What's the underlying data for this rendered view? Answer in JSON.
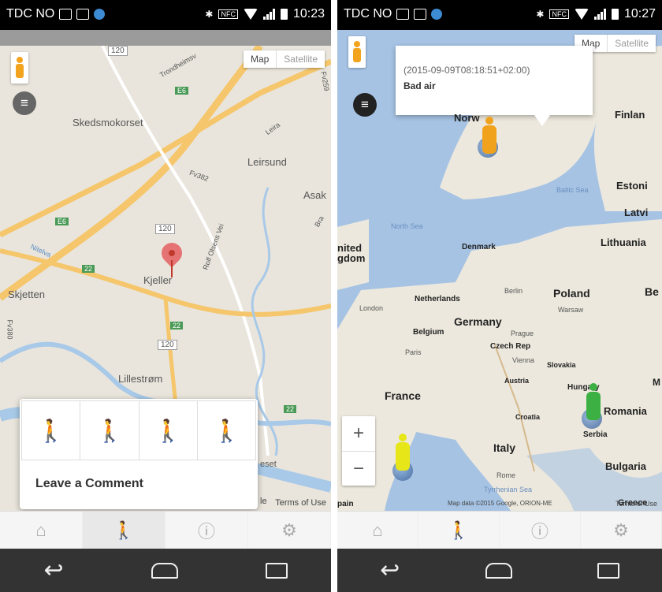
{
  "status_bar": {
    "carrier": "TDC NO",
    "nfc": "NFC",
    "time_left": "10:23",
    "time_right": "10:27"
  },
  "map_type": {
    "map": "Map",
    "satellite": "Satellite"
  },
  "map1": {
    "labels": {
      "skedsmokorset": "Skedsmokorset",
      "leirsund": "Leirsund",
      "asak": "Asak",
      "kjeller": "Kjeller",
      "skjetten": "Skjetten",
      "lillestrom": "Lillestrøm",
      "trondheimsveien": "Trondheimsv",
      "leira": "Leira",
      "fv382": "Fv382",
      "fv259": "Fv259",
      "e6_top": "E6",
      "e6_left": "E6",
      "r120_top": "120",
      "r120_mid": "120",
      "r120_bottom": "120",
      "r22_left": "22",
      "r22_mid": "22",
      "r22_right": "22",
      "nitelva": "Nitelva",
      "rolf": "Rolf Olsens Vei",
      "fv380": "Fv380",
      "eset": "eset",
      "bra": "Bra"
    },
    "terms": "Terms of Use",
    "google_fragment": "le",
    "comment": "Leave a Comment"
  },
  "map2": {
    "timestamp": "(2015-09-09T08:18:51+02:00)",
    "message": "Bad air",
    "labels": {
      "norway": "Norw",
      "finland": "Finlan",
      "estonia": "Estoni",
      "latvia": "Latvi",
      "lithuania": "Lithuania",
      "baltic": "Baltic Sea",
      "north_sea": "North Sea",
      "denmark": "Denmark",
      "uk": "nited\ngdom",
      "london": "London",
      "netherlands": "Netherlands",
      "berlin": "Berlin",
      "poland": "Poland",
      "warsaw": "Warsaw",
      "belgium": "Belgium",
      "germany": "Germany",
      "prague": "Prague",
      "paris": "Paris",
      "czech": "Czech Rep",
      "vienna": "Vienna",
      "slovakia": "Slovakia",
      "austria": "Austria",
      "hungary": "Hungary",
      "france": "France",
      "croatia": "Croatia",
      "romania": "Romania",
      "serbia": "Serbia",
      "italy": "Italy",
      "rome": "Rome",
      "bulgaria": "Bulgaria",
      "tyrrhenian": "Tyrrhenian Sea",
      "greece": "Greece",
      "be": "Be",
      "m": "M",
      "spain": "pain"
    },
    "copyright": "Map data ©2015 Google, ORION-ME",
    "terms": "Terms of Use",
    "zoom_in": "+",
    "zoom_out": "−"
  },
  "faces": [
    {
      "color": "#3cb043",
      "level": "green"
    },
    {
      "color": "#e6e619",
      "level": "yellow"
    },
    {
      "color": "#f0a21c",
      "level": "orange"
    },
    {
      "color": "#e03a3a",
      "level": "red"
    }
  ],
  "tabs": [
    "home-icon",
    "walker-icon",
    "info-icon",
    "settings-icon"
  ],
  "colors": {
    "accent_pin": "#e57373",
    "map_land": "#e9e5dc",
    "map_sea": "#a6c3e4"
  }
}
